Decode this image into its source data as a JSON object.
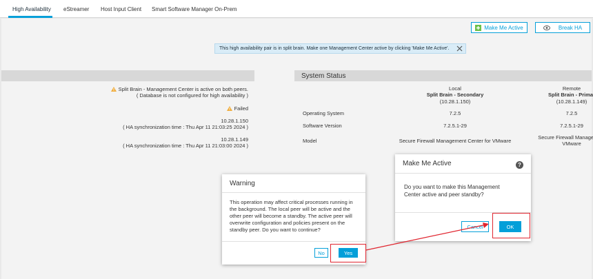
{
  "tabs": [
    {
      "label": "High Availability"
    },
    {
      "label": "eStreamer"
    },
    {
      "label": "Host Input Client"
    },
    {
      "label": "Smart Software Manager On-Prem"
    }
  ],
  "toolbar": {
    "make_me_active": "Make Me Active",
    "break_ha": "Break HA"
  },
  "banner": {
    "text": "This high availability pair is in split brain. Make one Management Center active by clicking 'Make Me Active'."
  },
  "left": {
    "split_brain_line1": "Split Brain - Management Center is active on both peers.",
    "split_brain_line2": "( Database is not configured for high availability )",
    "failed": "Failed",
    "peer1_ip": "10.28.1.150",
    "peer1_sync": "( HA synchronization time : Thu Apr 11 21:03:25 2024 )",
    "peer2_ip": "10.28.1.149",
    "peer2_sync": "( HA synchronization time : Thu Apr 11 21:03:00 2024 )"
  },
  "system_status": {
    "title": "System Status",
    "local": {
      "heading": "Local",
      "role": "Split Brain - Secondary",
      "ip": "(10.28.1.150)"
    },
    "remote": {
      "heading": "Remote",
      "role": "Split Brain - Primar",
      "ip": "(10.28.1.149)"
    },
    "rows": [
      {
        "label": "Operating System",
        "local": "7.2.5",
        "remote": "7.2.5"
      },
      {
        "label": "Software Version",
        "local": "7.2.5.1-29",
        "remote": "7.2.5.1-29"
      },
      {
        "label": "Model",
        "local": "Secure Firewall Management Center for VMware",
        "remote_line1": "Secure Firewall Management",
        "remote_line2": "VMware"
      }
    ]
  },
  "warning_dialog": {
    "title": "Warning",
    "lines": [
      "This operation may affect critical processes running in",
      "the background. The local peer will be active and the",
      "other peer will become a standby. The active peer will",
      "overwrite configuration and policies present on the",
      "standby peer. Do you want to continue?"
    ],
    "no": "No",
    "yes": "Yes"
  },
  "make_active_dialog": {
    "title": "Make Me Active",
    "lines": [
      "Do you want to make this Management",
      "Center active and peer standby?"
    ],
    "cancel": "Cancel",
    "ok": "OK"
  },
  "colors": {
    "accent": "#049fd9",
    "highlight": "#e0242e",
    "warning": "#f0ac3b",
    "success": "#6cc04a"
  }
}
